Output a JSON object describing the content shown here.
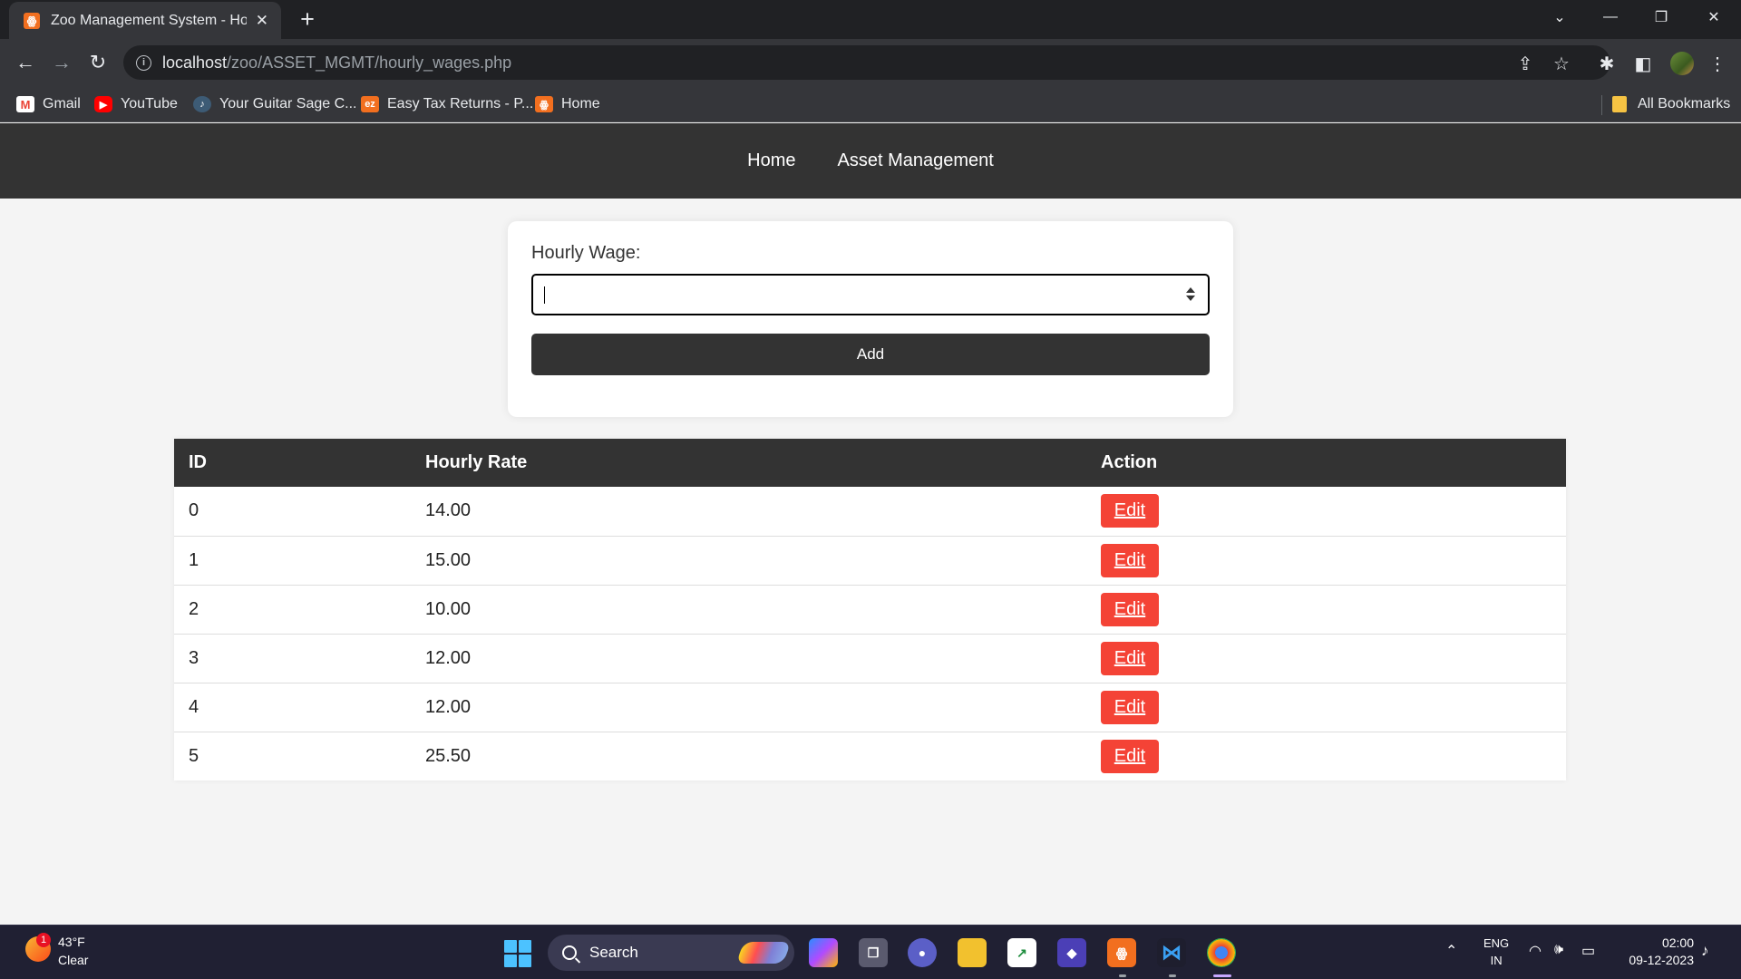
{
  "browser": {
    "tab_title": "Zoo Management System - Hourly Wages",
    "tab_favicon": "xampp-icon",
    "url_host": "localhost",
    "url_path": "/zoo/ASSET_MGMT/hourly_wages.php",
    "new_tab_symbol": "+",
    "close_symbol": "✕",
    "bookmarks": [
      {
        "label": "Gmail",
        "icon": "gmail-icon"
      },
      {
        "label": "YouTube",
        "icon": "youtube-icon"
      },
      {
        "label": "Your Guitar Sage C...",
        "icon": "guitar-sage-icon"
      },
      {
        "label": "Easy Tax Returns - P...",
        "icon": "ez-icon",
        "icon_text": "ez"
      },
      {
        "label": "Home",
        "icon": "xampp-icon"
      }
    ],
    "all_bookmarks_label": "All Bookmarks"
  },
  "nav": {
    "home": "Home",
    "asset_management": "Asset Management"
  },
  "form": {
    "label": "Hourly Wage:",
    "input_value": "",
    "add_label": "Add"
  },
  "table": {
    "headers": [
      "ID",
      "Hourly Rate",
      "Action"
    ],
    "rows": [
      {
        "id": "0",
        "rate": "14.00",
        "action": "Edit"
      },
      {
        "id": "1",
        "rate": "15.00",
        "action": "Edit"
      },
      {
        "id": "2",
        "rate": "10.00",
        "action": "Edit"
      },
      {
        "id": "3",
        "rate": "12.00",
        "action": "Edit"
      },
      {
        "id": "4",
        "rate": "12.00",
        "action": "Edit"
      },
      {
        "id": "5",
        "rate": "25.50",
        "action": "Edit"
      }
    ]
  },
  "taskbar": {
    "weather_temp": "43°F",
    "weather_desc": "Clear",
    "weather_badge": "1",
    "search_label": "Search",
    "lang_line1": "ENG",
    "lang_line2": "IN",
    "time": "02:00",
    "date": "09-12-2023"
  },
  "colors": {
    "nav_bg": "#333333",
    "edit_button": "#f44336",
    "page_bg": "#f4f4f4",
    "chrome_dark": "#202124",
    "chrome_toolbar": "#35363a"
  }
}
